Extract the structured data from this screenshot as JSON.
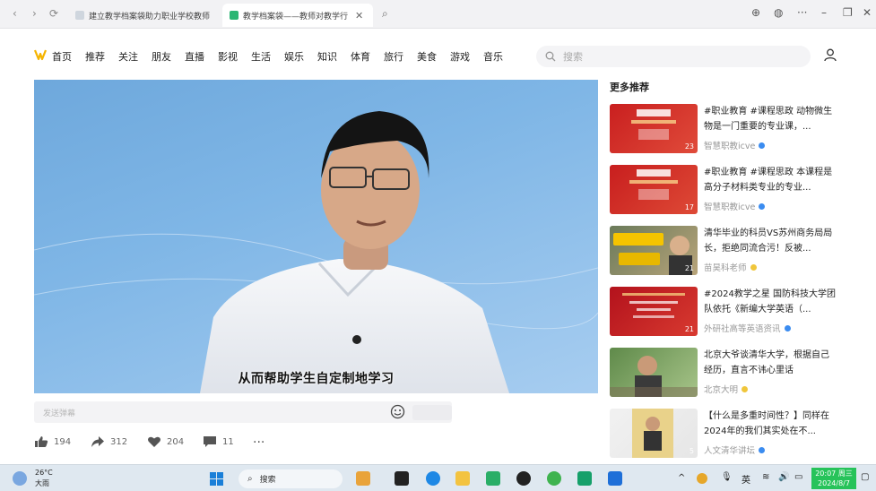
{
  "browser": {
    "tabs": [
      {
        "title": "建立教学档案袋助力职业学校教师"
      },
      {
        "title": "教学档案袋——教师对教学行"
      }
    ]
  },
  "site": {
    "nav": [
      "首页",
      "推荐",
      "关注",
      "朋友",
      "直播",
      "影视",
      "生活",
      "娱乐",
      "知识",
      "体育",
      "旅行",
      "美食",
      "游戏",
      "音乐"
    ],
    "search_placeholder": "搜索"
  },
  "video": {
    "subtitle": "从而帮助学生自定制地学习",
    "danmaku_placeholder": "发送弹幕"
  },
  "actions": {
    "likes": "194",
    "shares": "312",
    "favorites": "204",
    "comments": "11"
  },
  "recommend": {
    "heading": "更多推荐",
    "items": [
      {
        "title": "#职业教育 #课程思政 动物微生物是一门重要的专业课，...",
        "author": "智慧职教icve",
        "count": "23",
        "badge": "#3b8cf0",
        "thumb": "red"
      },
      {
        "title": "#职业教育 #课程思政 本课程是高分子材料类专业的专业...",
        "author": "智慧职教icve",
        "count": "17",
        "badge": "#3b8cf0",
        "thumb": "red"
      },
      {
        "title": "清华毕业的科员VS苏州商务局局长，拒绝同流合污！反被...",
        "author": "苗昊科老师",
        "count": "21",
        "badge": "#f0c63b",
        "thumb": "photo"
      },
      {
        "title": "#2024教学之星 国防科技大学团队依托《新编大学英语（...",
        "author": "外研社高等英语资讯",
        "count": "21",
        "badge": "#3b8cf0",
        "thumb": "red2"
      },
      {
        "title": "北京大爷谈清华大学，根据自己经历，直言不讳心里话",
        "author": "北京大明",
        "count": "",
        "badge": "#f0c63b",
        "thumb": "green"
      },
      {
        "title": "【什么是多重时间性？】同样在2024年的我们其实处在不...",
        "author": "人文清华讲坛",
        "count": "5",
        "badge": "#3b8cf0",
        "thumb": "light"
      }
    ]
  },
  "taskbar": {
    "weather_temp": "26°C",
    "weather_text": "大雨",
    "search_label": "搜索",
    "ime": "英",
    "time": "20:07 周三",
    "date": "2024/8/7"
  }
}
